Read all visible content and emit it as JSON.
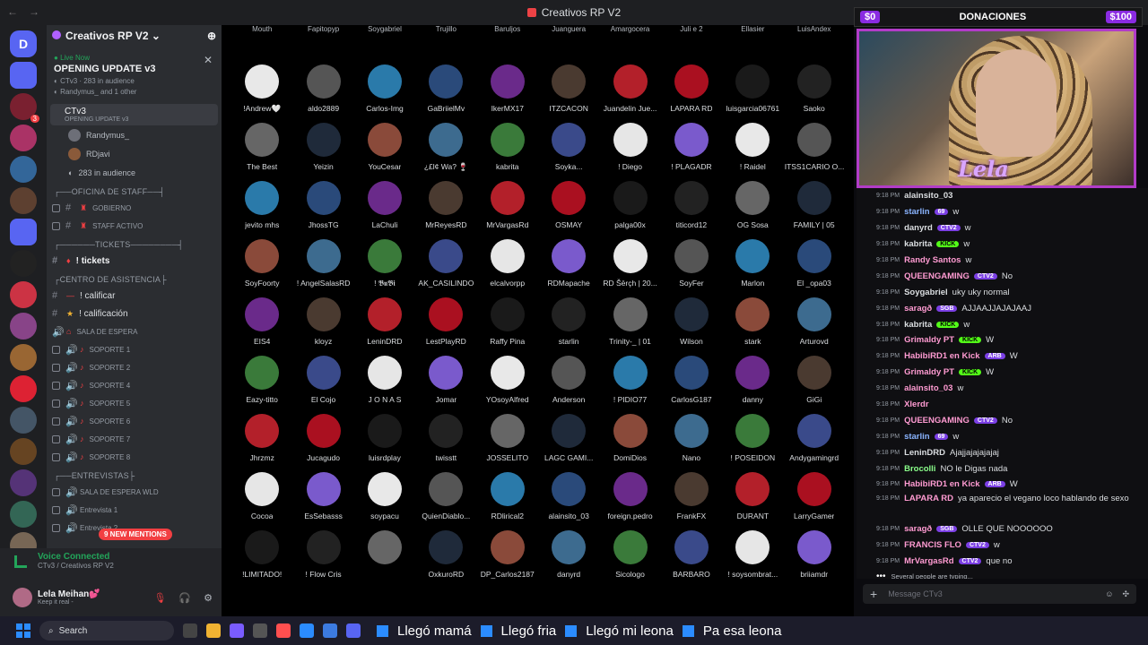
{
  "window": {
    "title": "Creativos RP V2"
  },
  "server": {
    "name": "Creativos RP V2"
  },
  "event": {
    "live_label": "Live Now",
    "title": "OPENING UPDATE v3",
    "channel": "CTv3",
    "audience": "283 in audience",
    "participants": "Randymus_ and 1 other"
  },
  "voice_channel": {
    "name": "CTv3",
    "subtitle": "OPENING UPDATE v3",
    "users": [
      "Randymus_",
      "RDjavi"
    ],
    "audience": "283 in audience"
  },
  "categories": [
    {
      "name": "┌──OFICINA DE STAFF──┤",
      "channels": [
        "GOBIERNO",
        "STAFF ACTIVO"
      ]
    },
    {
      "name": "┌──────TICKETS────────┤",
      "channels": [
        "! tickets"
      ]
    },
    {
      "name": "┌CENTRO DE ASISTENCIA├",
      "channels": [
        "! calificar",
        "! calificación",
        "SALA DE ESPERA",
        "SOPORTE 1",
        "SOPORTE 2",
        "SOPORTE 4",
        "SOPORTE 5",
        "SOPORTE 6",
        "SOPORTE 7",
        "SOPORTE 8"
      ]
    },
    {
      "name": "┌──ENTREVISTAS├",
      "channels": [
        "SALA DE ESPERA WLD",
        "Entrevista 1",
        "Entrevista 2"
      ]
    }
  ],
  "mentions_label": "9 NEW MENTIONS",
  "voice_status": {
    "connected": "Voice Connected",
    "location": "CTv3 / Creativos RP V2"
  },
  "user": {
    "name": "Lela Meihan💕",
    "status": "Keep it real -"
  },
  "top_partial_names": [
    "Mouth",
    "Fapitopyp",
    "Soygabriel",
    "Trujillo",
    "Baruljos",
    "Juanguera",
    "Amargocera",
    "Juli e 2",
    "Ellasier",
    "LuisAndex"
  ],
  "participants": [
    "!Andrew🤍",
    "aldo2889",
    "Carlos-Img",
    "GaBriielMv",
    "IkerMX17",
    "ITZCACON",
    "Juandelin Jue...",
    "LAPARA RD",
    "luisgarcia06761",
    "Saoko",
    "The Best",
    "Yeizin",
    "YouCesar",
    "¿£l¢ Wa? 🍷",
    "kabrita",
    "Soyka...",
    "! Diego",
    "! PLAGADR",
    "! Raidel",
    "ITSS1CARIO O...",
    "jevito mhs",
    "JhossTG",
    "LaChuli",
    "MrReyesRD",
    "MrVargasRd",
    "OSMAY",
    "palga00x",
    "titicord12",
    "OG Sosa",
    "FAMILY | 05",
    "SoyFoorty",
    "! AngelSalasRD",
    "! 𝕭𝖚𝕭𝖎",
    "AK_CASILINDO",
    "elcalvorpp",
    "RDMapache",
    "RD Šērçh | 20...",
    "SoyFer",
    "Marlon",
    "El _opa03",
    "EIS4",
    "kloyz",
    "LeninDRD",
    "LestPlayRD",
    "Raffy Pina",
    "starlin",
    "Trinity-_ | 01",
    "Wilson",
    "stark",
    "Arturovd",
    "Eazy-titto",
    "El Cojo",
    "J O N A S",
    "Jomar",
    "YOsoyAlfred",
    "Anderson",
    "! PIDIO77",
    "CarlosG187",
    "danny",
    "GiGi",
    "Jhrzmz",
    "Jucagudo",
    "luisrdplay",
    "twisstt",
    "JOSSELITO",
    "LAGC GAMI...",
    "DomiDios",
    "Nano",
    "! POSEIDON",
    "Andygamingrd",
    "Cocoa",
    "EsSebasss",
    "soypacu",
    "QuienDiablo...",
    "RDlirical2",
    "alainsito_03",
    "foreign.pedro",
    "FrankFX",
    "DURANT",
    "LarryGamer",
    "!LIMITADO!",
    "! Flow Cris",
    "",
    "OxkuroRD",
    "DP_Carlos2187",
    "danyrd",
    "Sicologo",
    "BARBARO",
    "! soysombrat...",
    "briiamdr"
  ],
  "donations": {
    "left": "$0",
    "title": "DONACIONES",
    "right": "$100"
  },
  "cam_name": "Lela",
  "chat": [
    {
      "time": "9:18 PM",
      "user": "alainsito_03",
      "color": "#dbdee1",
      "badge": "",
      "text": ""
    },
    {
      "time": "9:18 PM",
      "user": "starlin",
      "color": "#8ab4ff",
      "badge": "69",
      "text": "w"
    },
    {
      "time": "9:18 PM",
      "user": "danyrd",
      "color": "#dbdee1",
      "badge": "CTV2",
      "text": "w"
    },
    {
      "time": "9:18 PM",
      "user": "kabrita",
      "color": "#dbdee1",
      "badge": "KICK",
      "text": "w"
    },
    {
      "time": "9:18 PM",
      "user": "Randy Santos",
      "color": "#ff9bd2",
      "badge": "",
      "text": "w"
    },
    {
      "time": "9:18 PM",
      "user": "QUEENGAMING",
      "color": "#ff9bd2",
      "badge": "CTV2",
      "text": "No"
    },
    {
      "time": "9:18 PM",
      "user": "Soygabriel",
      "color": "#dbdee1",
      "badge": "",
      "text": "uky uky normal"
    },
    {
      "time": "9:18 PM",
      "user": "saragð",
      "color": "#ff9bd2",
      "badge": "SGB",
      "text": "AJJAAJJAJAJAAJ"
    },
    {
      "time": "9:18 PM",
      "user": "kabrita",
      "color": "#dbdee1",
      "badge": "KICK",
      "text": "w"
    },
    {
      "time": "9:18 PM",
      "user": "Grimaldy PT",
      "color": "#ff9bd2",
      "badge": "KICK",
      "text": "W"
    },
    {
      "time": "9:18 PM",
      "user": "HabibiRD1 en Kick",
      "color": "#ff9bd2",
      "badge": "ARB",
      "text": "W"
    },
    {
      "time": "9:18 PM",
      "user": "Grimaldy PT",
      "color": "#ff9bd2",
      "badge": "KICK",
      "text": "W"
    },
    {
      "time": "9:18 PM",
      "user": "alainsito_03",
      "color": "#ff9bd2",
      "badge": "",
      "text": "w"
    },
    {
      "time": "9:18 PM",
      "user": "Xlerdr",
      "color": "#ff9bd2",
      "badge": "",
      "text": ""
    },
    {
      "time": "9:18 PM",
      "user": "QUEENGAMING",
      "color": "#ff9bd2",
      "badge": "CTV2",
      "text": "No"
    },
    {
      "time": "9:18 PM",
      "user": "starlin",
      "color": "#8ab4ff",
      "badge": "69",
      "text": "w"
    },
    {
      "time": "9:18 PM",
      "user": "LeninDRD",
      "color": "#dbdee1",
      "badge": "",
      "text": "Ajajjajajajajaj"
    },
    {
      "time": "9:18 PM",
      "user": "Brocolli",
      "color": "#8bff8b",
      "badge": "",
      "text": "NO le Digas nada"
    },
    {
      "time": "9:18 PM",
      "user": "HabibiRD1 en Kick",
      "color": "#ff9bd2",
      "badge": "ARB",
      "text": "W"
    },
    {
      "time": "9:18 PM",
      "user": "LAPARA RD",
      "color": "#ff9bd2",
      "badge": "",
      "text": "ya aparecio el vegano loco hablando de sexo",
      "wrap": true
    },
    {
      "time": "9:18 PM",
      "user": "saragð",
      "color": "#ff9bd2",
      "badge": "SGB",
      "text": "OLLE QUE NOOOOOO"
    },
    {
      "time": "9:18 PM",
      "user": "FRANCIS FLO",
      "color": "#ff9bd2",
      "badge": "CTV2",
      "text": "w"
    },
    {
      "time": "9:18 PM",
      "user": "MrVargasRd",
      "color": "#ff9bd2",
      "badge": "CTV2",
      "text": "que no"
    }
  ],
  "typing": "Several people are typing...",
  "composer": {
    "placeholder": "Message CTv3"
  },
  "taskbar": {
    "search": "Search"
  },
  "ticker": [
    "Llegó mamá",
    "Llegó fria",
    "Llegó mi leona",
    "Pa esa leona"
  ],
  "colors": {
    "accent": "#5865f2",
    "live": "#23a55a",
    "mention": "#f23f42",
    "frame": "#b23cc8"
  }
}
